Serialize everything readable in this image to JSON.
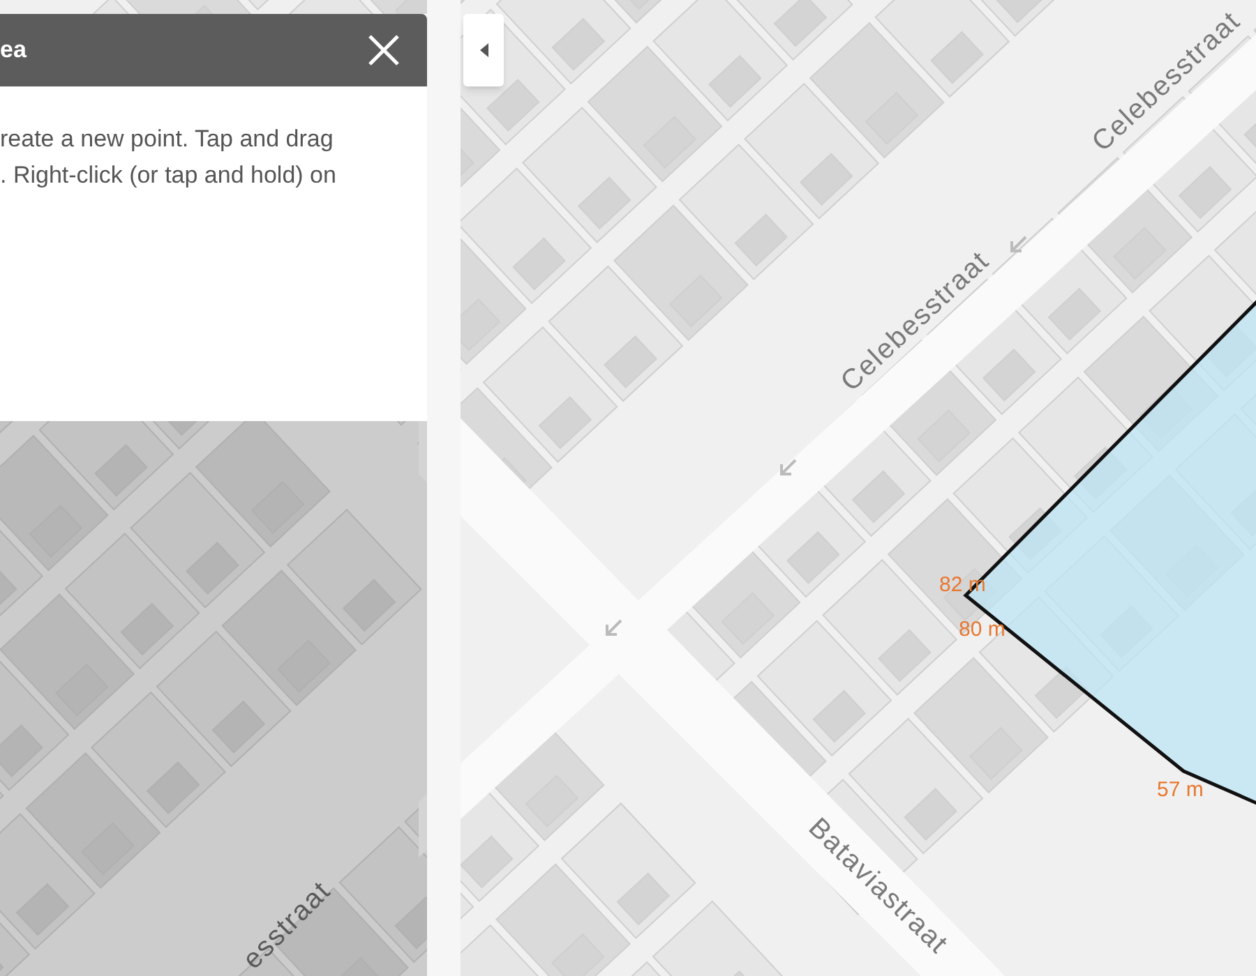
{
  "panel": {
    "title": "ea",
    "instructions": [
      "reate a new point. Tap and drag",
      ". Right-click (or tap and hold) on"
    ]
  },
  "map": {
    "street_labels": [
      "Celebesstraat",
      "Celebesstraat",
      "Bataviastraat",
      "esstraat"
    ],
    "measurements": [
      "82 m",
      "80 m",
      "57 m"
    ]
  }
}
